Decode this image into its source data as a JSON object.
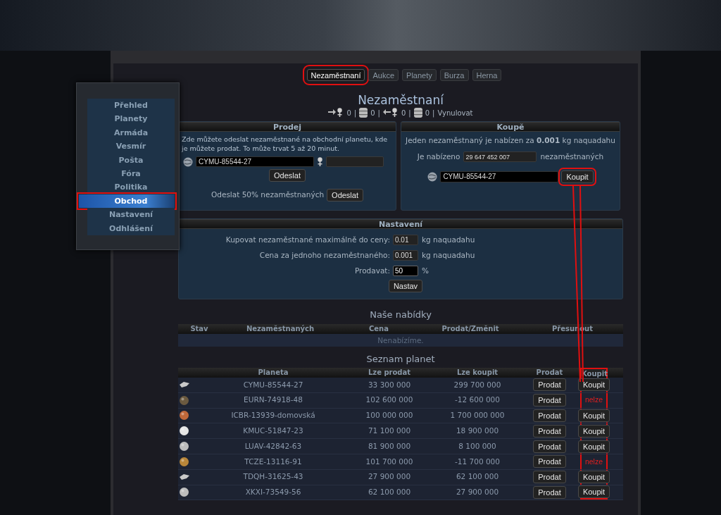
{
  "tabs": [
    {
      "label": "Nezaměstnaní",
      "selected": true,
      "highlighted": true
    },
    {
      "label": "Aukce",
      "selected": false,
      "highlighted": false
    },
    {
      "label": "Planety",
      "selected": false,
      "highlighted": false
    },
    {
      "label": "Burza",
      "selected": false,
      "highlighted": false
    },
    {
      "label": "Herna",
      "selected": false,
      "highlighted": false
    }
  ],
  "sidebar": {
    "items": [
      {
        "label": "Přehled",
        "selected": false,
        "highlighted": false
      },
      {
        "label": "Planety",
        "selected": false,
        "highlighted": false
      },
      {
        "label": "Armáda",
        "selected": false,
        "highlighted": false
      },
      {
        "label": "Vesmír",
        "selected": false,
        "highlighted": false
      },
      {
        "label": "Pošta",
        "selected": false,
        "highlighted": false
      },
      {
        "label": "Fóra",
        "selected": false,
        "highlighted": false
      },
      {
        "label": "Politika",
        "selected": false,
        "highlighted": false
      },
      {
        "label": "Obchod",
        "selected": true,
        "highlighted": true
      },
      {
        "label": "Nastavení",
        "selected": false,
        "highlighted": false
      },
      {
        "label": "Odhlášení",
        "selected": false,
        "highlighted": false
      }
    ]
  },
  "title": "Nezaměstnaní",
  "stats": [
    {
      "kind": "sent",
      "value": "0",
      "separator": "|"
    },
    {
      "kind": "naquadah",
      "value": "0",
      "separator": "|"
    },
    {
      "kind": "received",
      "value": "0",
      "separator": "|"
    },
    {
      "kind": "naquadah",
      "value": "0",
      "separator": "|"
    }
  ],
  "reset_link": "Vynulovat",
  "sell": {
    "title": "Prodej",
    "text": "Zde můžete odeslat nezaměstnané na obchodní planetu, kde je můžete prodat. To může trvat 5 až 20 minut.",
    "planet_value": "CYMU-85544-27",
    "send_button": "Odeslat",
    "half_label": "Odeslat 50% nezaměstnaných",
    "half_button": "Odeslat"
  },
  "buy": {
    "title": "Koupě",
    "text": "Jeden nezaměstnaný je nabízen za **0.001** kg naquadahu",
    "offered_label": "Je nabízeno",
    "offered_value": "29 647 452 007",
    "offered_unit": "nezaměstnaných",
    "planet_value": "CYMU-85544-27",
    "buy_button": {
      "label": "Koupit",
      "highlighted": true
    }
  },
  "settings": {
    "title": "Nastavení",
    "fields": [
      {
        "label": "Kupovat nezaměstnané maximálně do ceny:",
        "value": "0.01",
        "unit": "kg naquadahu",
        "focused": false
      },
      {
        "label": "Cena za jednoho nezaměstnaného:",
        "value": "0.001",
        "unit": "kg naquadahu",
        "focused": false
      },
      {
        "label": "Prodavat:",
        "value": "50",
        "unit": "%",
        "focused": true
      }
    ],
    "button": "Nastav"
  },
  "offers": {
    "title": "Naše nabídky",
    "columns": [
      "Stav",
      "Nezaměstnaných",
      "Cena",
      "Prodat/Změnit",
      "Přesunout"
    ],
    "empty": "Nenabízíme."
  },
  "planets": {
    "title": "Seznam planet",
    "columns": [
      {
        "label": "Planeta",
        "highlighted": false
      },
      {
        "label": "Lze prodat",
        "highlighted": false
      },
      {
        "label": "Lze koupit",
        "highlighted": false
      },
      {
        "label": "Prodat",
        "highlighted": false
      },
      {
        "label": "Koupit",
        "highlighted": true
      }
    ],
    "rows": [
      {
        "kind": "asteroid",
        "name": "CYMU-85544-27",
        "sellable": "33 300 000",
        "buyable": "299 700 000",
        "sell_button": "Prodat",
        "buy": {
          "kind": "button",
          "label": "Koupit"
        }
      },
      {
        "kind": "rocky",
        "name": "EURN-74918-48",
        "sellable": "102 600 000",
        "buyable": "-12 600 000",
        "sell_button": "Prodat",
        "buy": {
          "kind": "unavailable",
          "label": "nelze"
        }
      },
      {
        "kind": "red",
        "name": "ICBR-13939-domovská",
        "sellable": "100 000 000",
        "buyable": "1 700 000 000",
        "sell_button": "Prodat",
        "buy": {
          "kind": "button",
          "label": "Koupit"
        }
      },
      {
        "kind": "white",
        "name": "KMUC-51847-23",
        "sellable": "71 100 000",
        "buyable": "18 900 000",
        "sell_button": "Prodat",
        "buy": {
          "kind": "button",
          "label": "Koupit"
        }
      },
      {
        "kind": "moon",
        "name": "LUAV-42842-63",
        "sellable": "81 900 000",
        "buyable": "8 100 000",
        "sell_button": "Prodat",
        "buy": {
          "kind": "button",
          "label": "Koupit"
        }
      },
      {
        "kind": "orange",
        "name": "TCZE-13116-91",
        "sellable": "101 700 000",
        "buyable": "-11 700 000",
        "sell_button": "Prodat",
        "buy": {
          "kind": "unavailable",
          "label": "nelze"
        }
      },
      {
        "kind": "asteroid",
        "name": "TDQH-31625-43",
        "sellable": "27 900 000",
        "buyable": "62 100 000",
        "sell_button": "Prodat",
        "buy": {
          "kind": "button",
          "label": "Koupit"
        }
      },
      {
        "kind": "moon",
        "name": "XKXI-73549-56",
        "sellable": "62 100 000",
        "buyable": "27 900 000",
        "sell_button": "Prodat",
        "buy": {
          "kind": "button",
          "label": "Koupit"
        }
      }
    ]
  }
}
